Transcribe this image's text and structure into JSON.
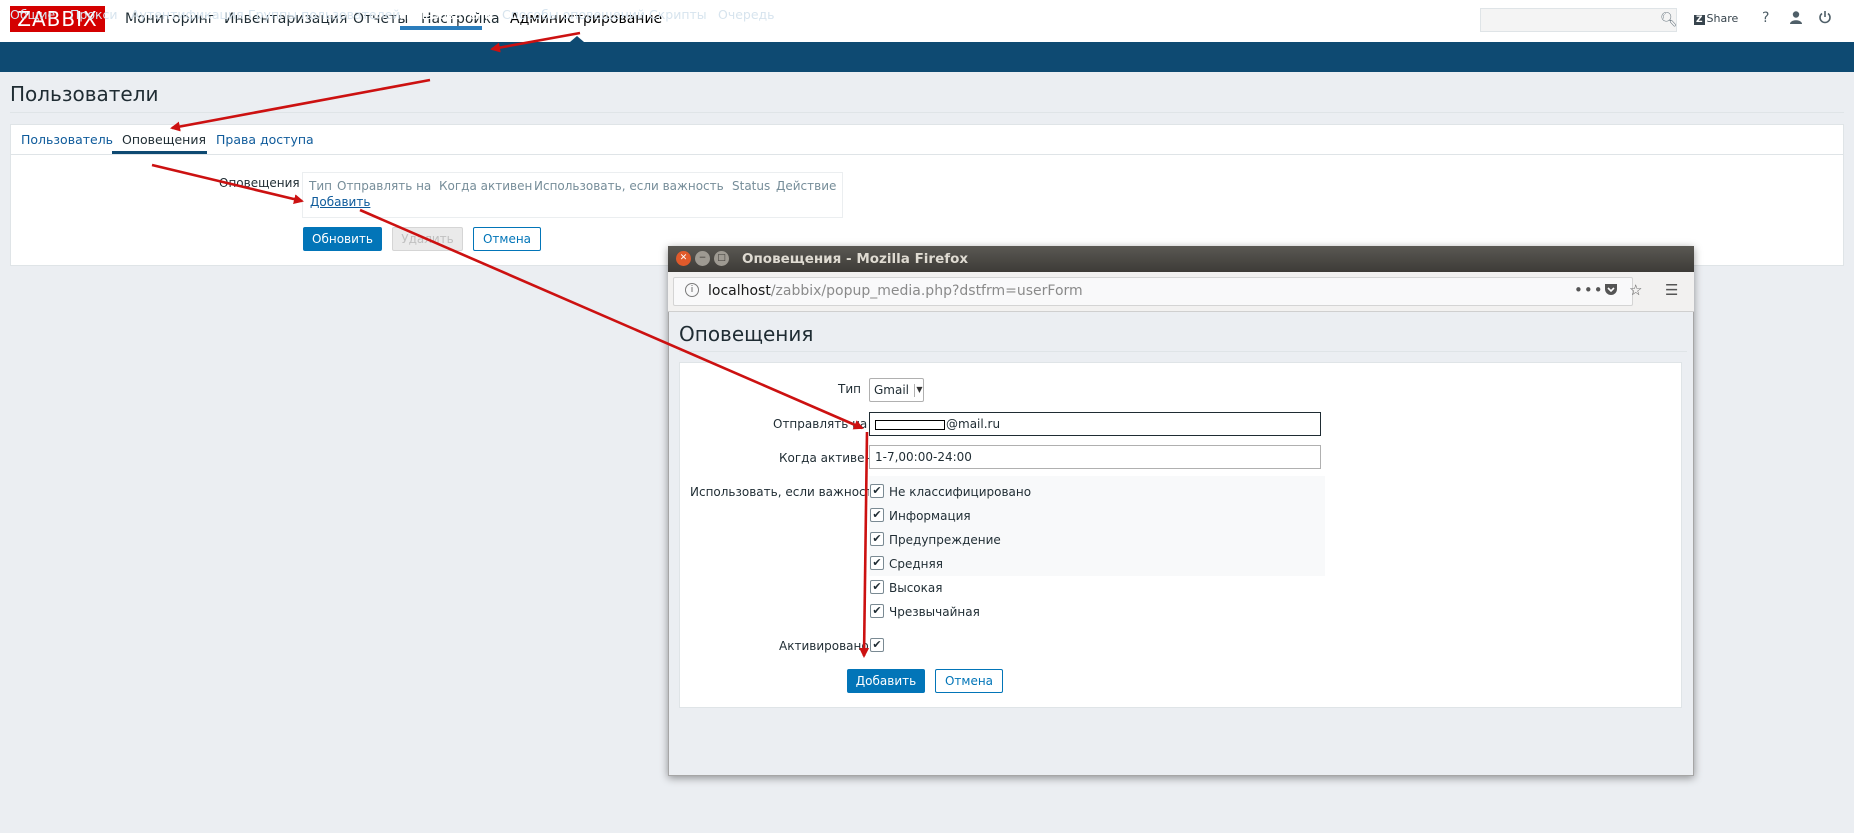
{
  "header": {
    "logo": "ZABBIX",
    "menu": [
      "Мониторинг",
      "Инвентаризация",
      "Отчеты",
      "Настройка",
      "Администрирование"
    ],
    "share": "Share",
    "help_icon": "?",
    "user_icon": "user-icon",
    "logout_icon": "power-icon"
  },
  "subnav": [
    "Общие",
    "Прокси",
    "Аутентификация",
    "Группы пользователей",
    "Пользователи",
    "Способы оповещений",
    "Скрипты",
    "Очередь"
  ],
  "page": {
    "title": "Пользователи",
    "tabs": [
      "Пользователь",
      "Оповещения",
      "Права доступа"
    ],
    "media_label": "Оповещения",
    "table_headers": [
      "Тип",
      "Отправлять на",
      "Когда активен",
      "Использовать, если важность",
      "Status",
      "Действие"
    ],
    "add_link": "Добавить",
    "buttons": {
      "update": "Обновить",
      "delete": "Удалить",
      "cancel": "Отмена"
    }
  },
  "popup": {
    "window_title": "Оповещения - Mozilla Firefox",
    "url_host": "localhost",
    "url_path": "/zabbix/popup_media.php?dstfrm=userForm",
    "heading": "Оповещения",
    "labels": {
      "type": "Тип",
      "send_to": "Отправлять на",
      "when_active": "Когда активен",
      "use_if_severity": "Использовать, если важность",
      "enabled": "Активировано"
    },
    "type_value": "Gmail",
    "send_to_value": "@mail.ru",
    "when_active_value": "1-7,00:00-24:00",
    "severities": [
      {
        "label": "Не классифицировано",
        "checked": true
      },
      {
        "label": "Информация",
        "checked": true
      },
      {
        "label": "Предупреждение",
        "checked": true
      },
      {
        "label": "Средняя",
        "checked": true
      },
      {
        "label": "Высокая",
        "checked": true
      },
      {
        "label": "Чрезвычайная",
        "checked": true
      }
    ],
    "enabled": true,
    "buttons": {
      "add": "Добавить",
      "cancel": "Отмена"
    }
  },
  "colors": {
    "brand": "#d40000",
    "nav": "#0e4a72",
    "primary": "#0275b8",
    "annotation_arrow": "#cc1111"
  }
}
